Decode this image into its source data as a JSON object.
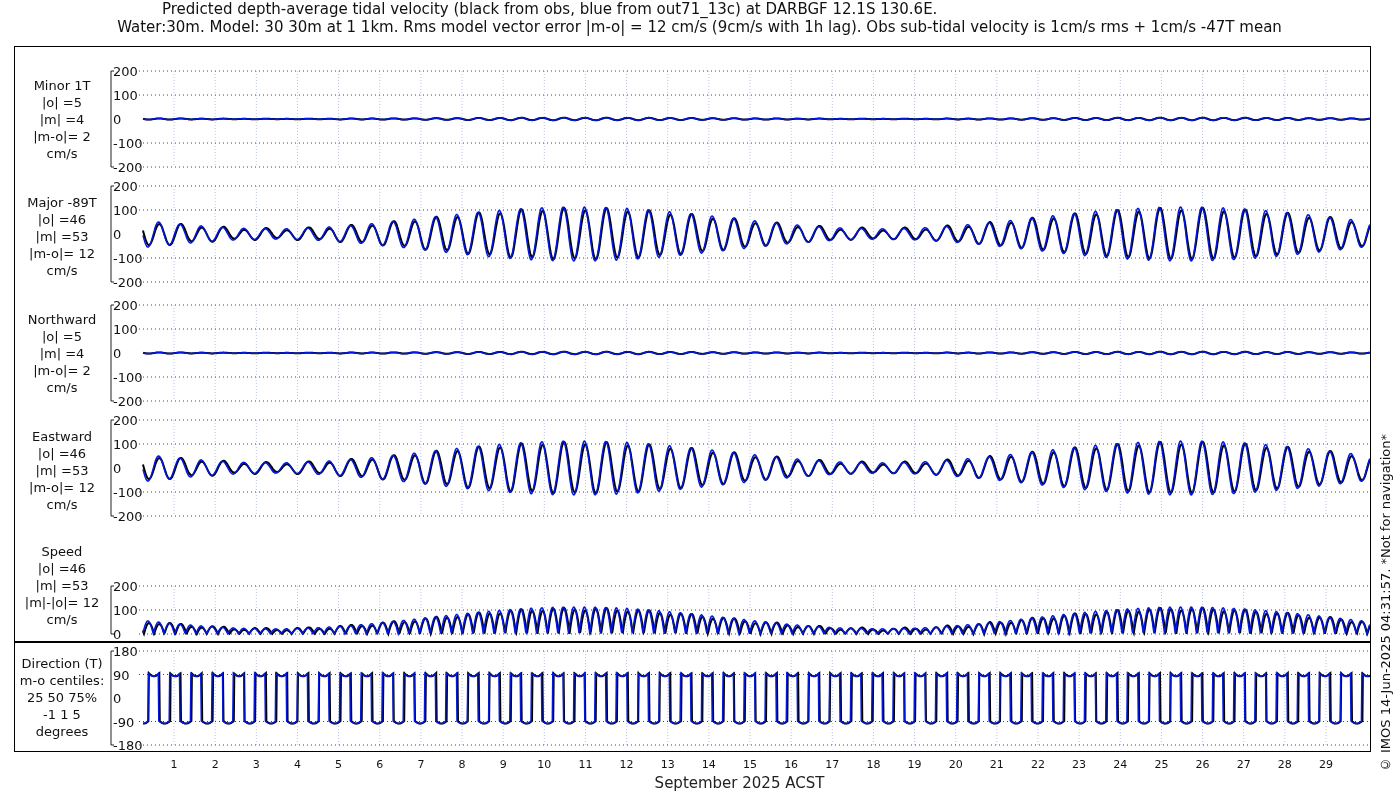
{
  "title": {
    "lines": [
      "Predicted depth-average tidal velocity (black from obs, blue from out71_13c) at DARBGF 12.1S 130.6E.",
      "Water:30m. Model: 30 30m at 1 1km. Rms model vector error |m-o| = 12 cm/s (9cm/s with 1h lag). Obs sub-tidal velocity is 1cm/s rms + 1cm/s -47T mean"
    ]
  },
  "panels": [
    {
      "kind": "weak",
      "label_lines": [
        "Minor 1T",
        "|o| =5",
        "|m| =4",
        "|m-o|= 2",
        "cm/s"
      ],
      "y_tick_labels": [
        "200",
        "100",
        "0",
        "-100",
        "-200"
      ]
    },
    {
      "kind": "strong",
      "label_lines": [
        "Major -89T",
        "|o| =46",
        "|m| =53",
        "|m-o|= 12",
        "cm/s"
      ],
      "y_tick_labels": [
        "200",
        "100",
        "0",
        "-100",
        "-200"
      ]
    },
    {
      "kind": "weak",
      "label_lines": [
        "Northward",
        "|o| =5",
        "|m| =4",
        "|m-o|= 2",
        "cm/s"
      ],
      "y_tick_labels": [
        "200",
        "100",
        "0",
        "-100",
        "-200"
      ]
    },
    {
      "kind": "strong",
      "label_lines": [
        "Eastward",
        "|o| =46",
        "|m| =53",
        "|m-o|= 12",
        "cm/s"
      ],
      "y_tick_labels": [
        "200",
        "100",
        "0",
        "-100",
        "-200"
      ]
    },
    {
      "kind": "speed",
      "label_lines": [
        "Speed",
        "|o| =46",
        "|m| =53",
        "|m|-|o|= 12",
        "cm/s"
      ],
      "y_tick_labels": [
        "200",
        "100",
        "0"
      ]
    },
    {
      "kind": "direction",
      "label_lines": [
        "Direction (T)",
        "m-o centiles:",
        "25  50  75%",
        "-1  1  5",
        "degrees"
      ],
      "y_tick_labels": [
        "180",
        "90",
        "0",
        "-90",
        "-180"
      ]
    }
  ],
  "x_tick_labels": [
    "1",
    "2",
    "3",
    "4",
    "5",
    "6",
    "7",
    "8",
    "9",
    "10",
    "11",
    "12",
    "13",
    "14",
    "15",
    "16",
    "17",
    "18",
    "19",
    "20",
    "21",
    "22",
    "23",
    "24",
    "25",
    "26",
    "27",
    "28",
    "29"
  ],
  "xlabel": "September 2025 ACST",
  "footer_note": "© IMOS 14-Jun-2025 04:31:57. *Not for navigation*"
}
